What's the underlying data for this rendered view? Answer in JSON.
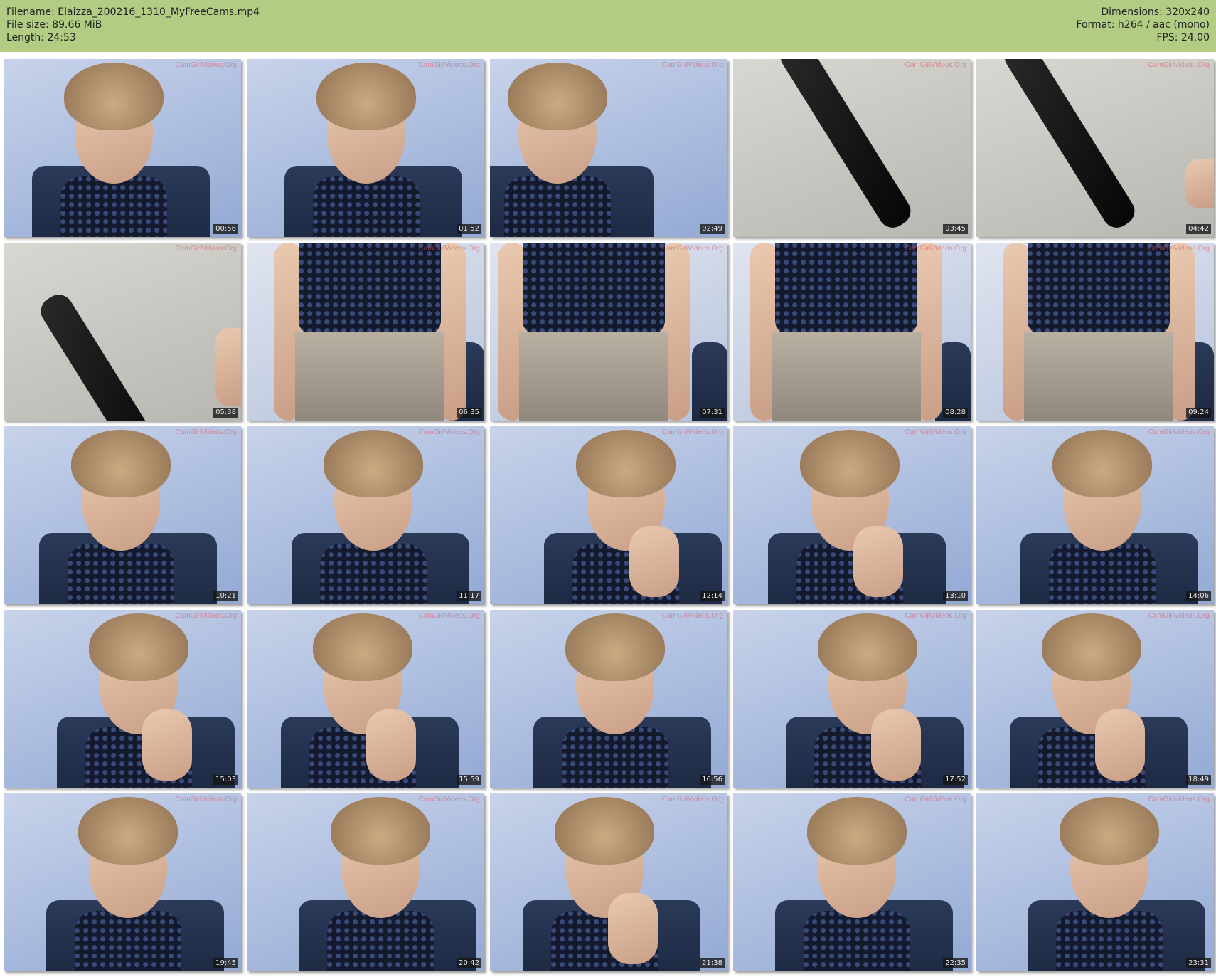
{
  "header": {
    "left": [
      "Filename: Elaizza_200216_1310_MyFreeCams.mp4",
      "File size: 89.66 MiB",
      "Length: 24:53"
    ],
    "right": [
      "Dimensions: 320x240",
      "Format: h264 / aac (mono)",
      "FPS: 24.00"
    ],
    "bg_color": "#b3cc83"
  },
  "watermark": "CamGirlVideos.Org",
  "thumbs": [
    {
      "time": "00:56",
      "scene": "portrait"
    },
    {
      "time": "01:52",
      "scene": "portrait"
    },
    {
      "time": "02:49",
      "scene": "portrait-left"
    },
    {
      "time": "03:45",
      "scene": "leg"
    },
    {
      "time": "04:42",
      "scene": "leg"
    },
    {
      "time": "05:38",
      "scene": "leg-low"
    },
    {
      "time": "06:35",
      "scene": "torso"
    },
    {
      "time": "07:31",
      "scene": "torso"
    },
    {
      "time": "08:28",
      "scene": "torso"
    },
    {
      "time": "09:24",
      "scene": "torso"
    },
    {
      "time": "10:21",
      "scene": "portrait"
    },
    {
      "time": "11:17",
      "scene": "portrait"
    },
    {
      "time": "12:14",
      "scene": "portrait-hand"
    },
    {
      "time": "13:10",
      "scene": "portrait-hand"
    },
    {
      "time": "14:06",
      "scene": "portrait"
    },
    {
      "time": "15:03",
      "scene": "portrait-hand"
    },
    {
      "time": "15:59",
      "scene": "portrait-hand"
    },
    {
      "time": "16:56",
      "scene": "portrait"
    },
    {
      "time": "17:52",
      "scene": "portrait-hand"
    },
    {
      "time": "18:49",
      "scene": "portrait-hand"
    },
    {
      "time": "19:45",
      "scene": "portrait"
    },
    {
      "time": "20:42",
      "scene": "portrait"
    },
    {
      "time": "21:38",
      "scene": "portrait-hand"
    },
    {
      "time": "22:35",
      "scene": "portrait"
    },
    {
      "time": "23:31",
      "scene": "portrait"
    }
  ]
}
